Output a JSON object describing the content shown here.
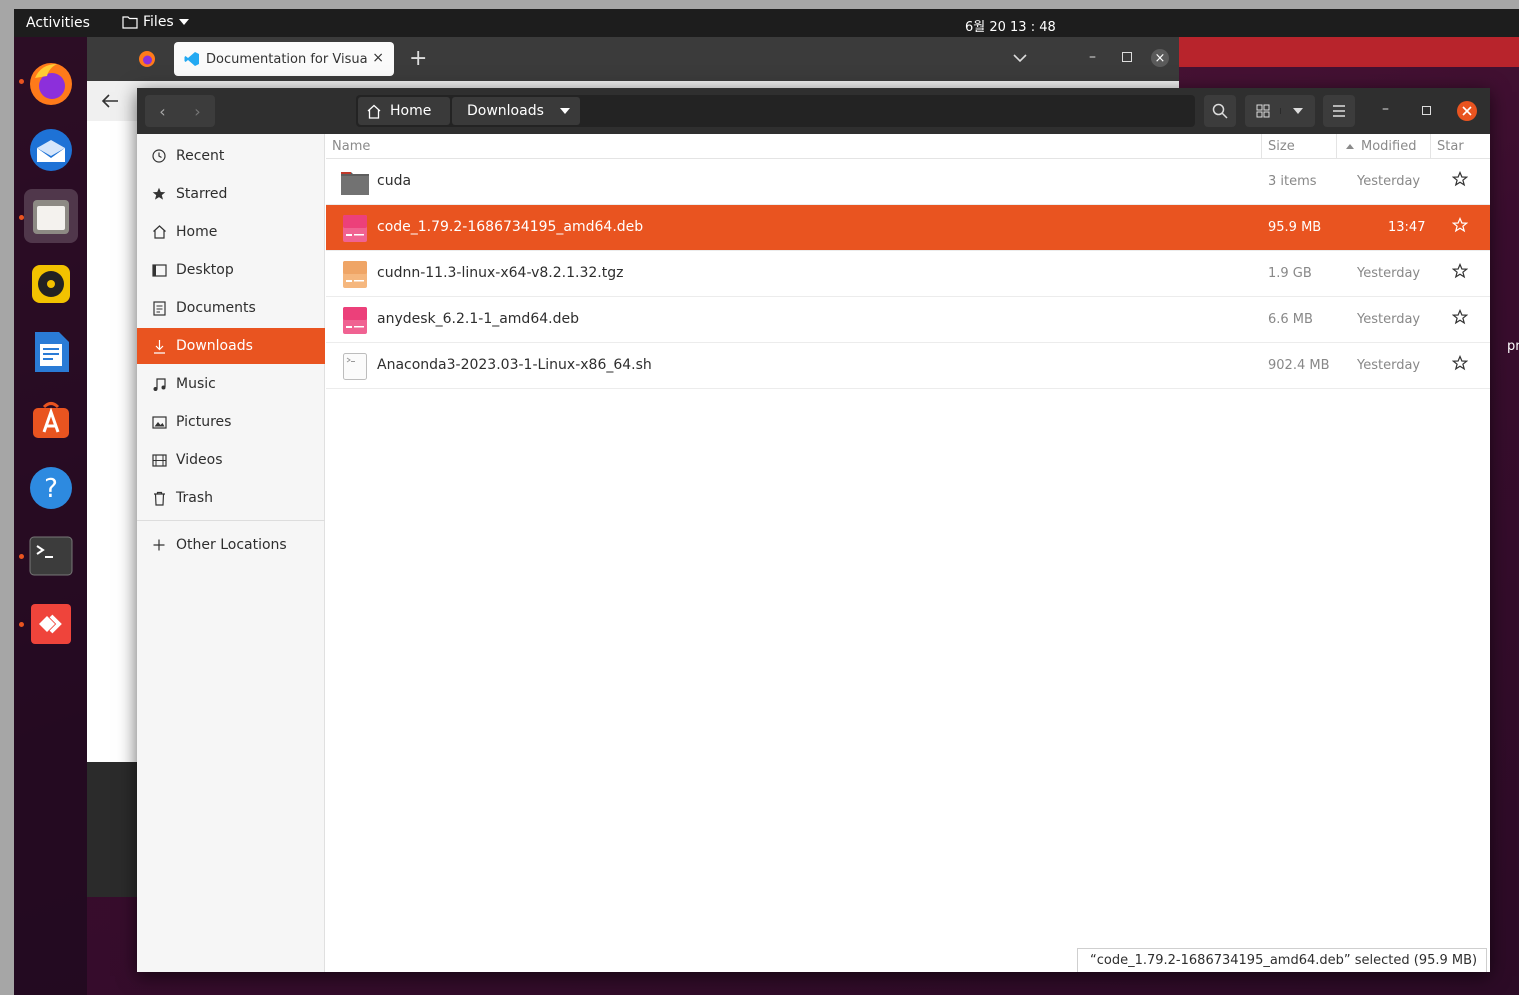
{
  "topbar": {
    "activities": "Activities",
    "app_menu": "Files",
    "clock": "6월 20  13 : 48"
  },
  "browser": {
    "tab_title": "Documentation for Visua"
  },
  "header": {
    "path_home": "Home",
    "path_current": "Downloads"
  },
  "sidebar": {
    "items": [
      {
        "label": "Recent",
        "icon": "clock-icon"
      },
      {
        "label": "Starred",
        "icon": "star-icon"
      },
      {
        "label": "Home",
        "icon": "home-icon"
      },
      {
        "label": "Desktop",
        "icon": "desktop-icon"
      },
      {
        "label": "Documents",
        "icon": "documents-icon"
      },
      {
        "label": "Downloads",
        "icon": "download-icon"
      },
      {
        "label": "Music",
        "icon": "music-icon"
      },
      {
        "label": "Pictures",
        "icon": "pictures-icon"
      },
      {
        "label": "Videos",
        "icon": "videos-icon"
      },
      {
        "label": "Trash",
        "icon": "trash-icon"
      }
    ],
    "other_locations": "Other Locations"
  },
  "columns": {
    "name": "Name",
    "size": "Size",
    "modified": "Modified",
    "star": "Star"
  },
  "files": [
    {
      "name": "cuda",
      "size": "3 items",
      "modified": "Yesterday",
      "type": "folder"
    },
    {
      "name": "code_1.79.2-1686734195_amd64.deb",
      "size": "95.9 MB",
      "modified": "13:47",
      "type": "deb"
    },
    {
      "name": "cudnn-11.3-linux-x64-v8.2.1.32.tgz",
      "size": "1.9 GB",
      "modified": "Yesterday",
      "type": "archive"
    },
    {
      "name": "anydesk_6.2.1-1_amd64.deb",
      "size": "6.6 MB",
      "modified": "Yesterday",
      "type": "deb"
    },
    {
      "name": "Anaconda3-2023.03-1-Linux-x86_64.sh",
      "size": "902.4 MB",
      "modified": "Yesterday",
      "type": "script"
    }
  ],
  "status": "“code_1.79.2-1686734195_amd64.deb” selected  (95.9 MB)",
  "edge_text": "pn_",
  "colors": {
    "accent": "#e95420",
    "header": "#2f2f2f"
  }
}
